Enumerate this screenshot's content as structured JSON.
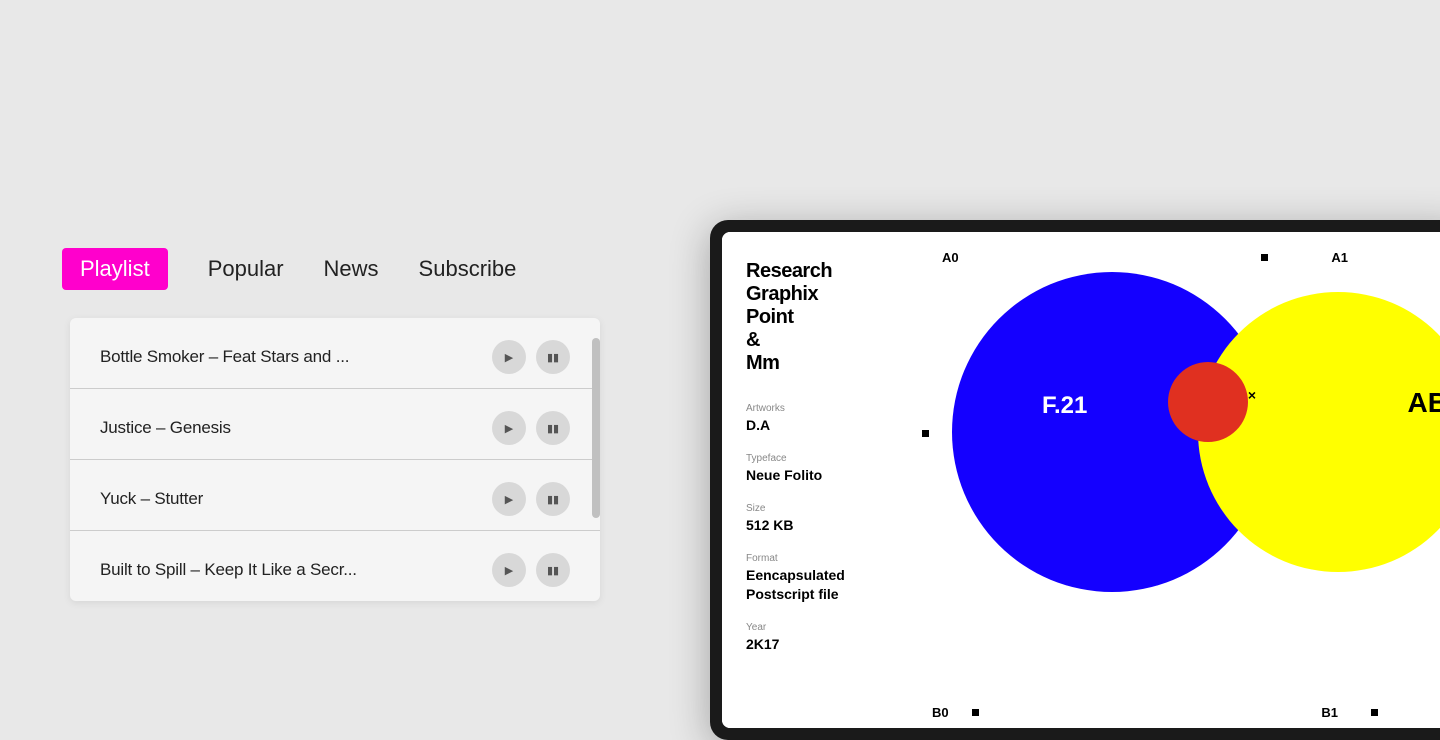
{
  "nav": {
    "tabs": [
      {
        "id": "playlist",
        "label": "Playlist",
        "active": true
      },
      {
        "id": "popular",
        "label": "Popular",
        "active": false
      },
      {
        "id": "news",
        "label": "News",
        "active": false
      },
      {
        "id": "subscribe",
        "label": "Subscribe",
        "active": false
      }
    ]
  },
  "playlist": {
    "tracks": [
      {
        "id": 1,
        "title": "Bottle Smoker –  Feat Stars and ..."
      },
      {
        "id": 2,
        "title": "Justice – Genesis"
      },
      {
        "id": 3,
        "title": "Yuck – Stutter"
      },
      {
        "id": 4,
        "title": "Built to Spill – Keep It Like a Secr..."
      }
    ]
  },
  "tablet": {
    "info": {
      "title": "Research\nGraphix\nPoint\n&\nMm",
      "artworks_label": "Artworks",
      "artworks_value": "D.A",
      "typeface_label": "Typeface",
      "typeface_value": "Neue Folito",
      "size_label": "Size",
      "size_value": "512 KB",
      "format_label": "Format",
      "format_value": "Eencapsulated\nPostscript file",
      "year_label": "Year",
      "year_value": "2K17"
    },
    "chart": {
      "grid_labels": [
        "A0",
        "A1",
        "B0",
        "B1"
      ],
      "labels": {
        "center": "F.21",
        "right": "AB",
        "overlap": "×"
      }
    }
  }
}
